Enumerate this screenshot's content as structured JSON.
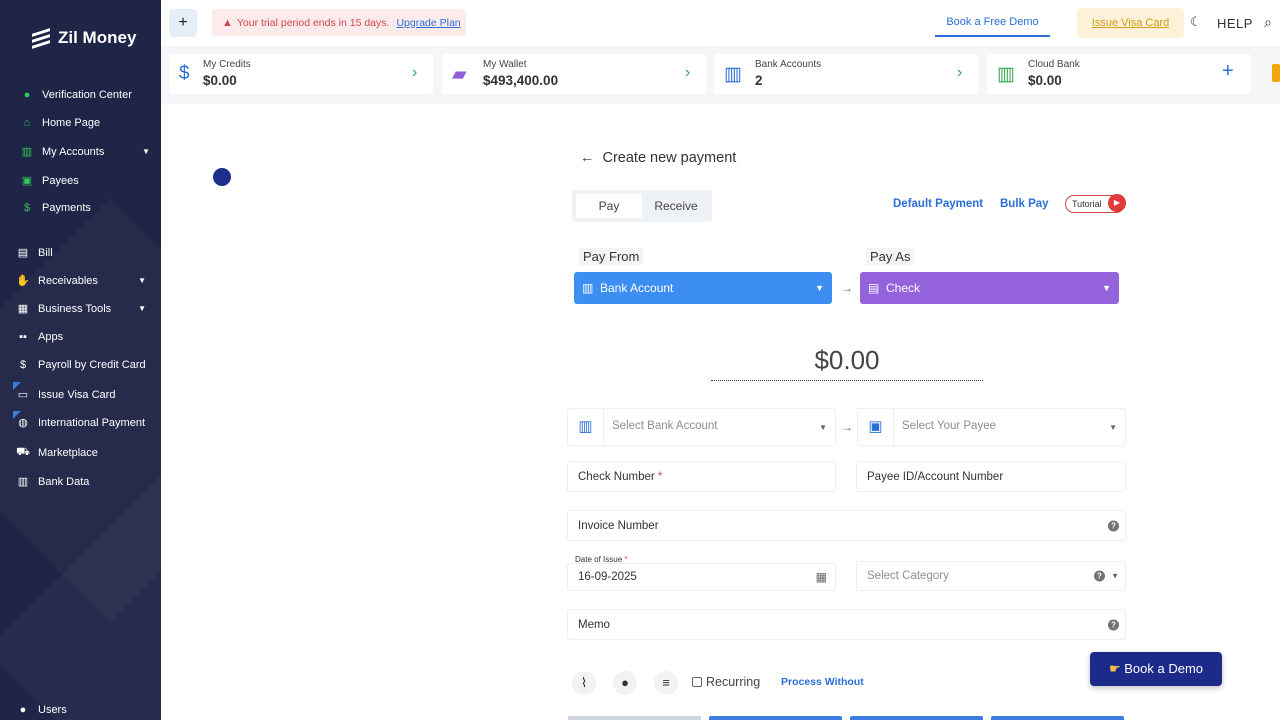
{
  "sidebar": {
    "brand": "Zil Money",
    "items": [
      {
        "label": "Verification Center",
        "icon": "check-circle-icon",
        "color": "#34c759"
      },
      {
        "label": "Home Page",
        "icon": "home-icon",
        "color": "#34c759"
      },
      {
        "label": "My Accounts",
        "icon": "bank-icon",
        "color": "#34c759"
      },
      {
        "label": "Payees",
        "icon": "contact-icon",
        "color": "#34c759"
      },
      {
        "label": "Payments",
        "icon": "dollar-icon",
        "color": "#34c759"
      },
      {
        "label": "Bill",
        "icon": "document-icon"
      },
      {
        "label": "Receivables",
        "icon": "hand-coin-icon"
      },
      {
        "label": "Business Tools",
        "icon": "briefcase-icon"
      },
      {
        "label": "Apps",
        "icon": "grid-icon"
      },
      {
        "label": "Payroll by Credit Card",
        "icon": "dollar-icon"
      },
      {
        "label": "Issue Visa Card",
        "icon": "card-icon"
      },
      {
        "label": "International Payment",
        "icon": "globe-icon"
      },
      {
        "label": "Marketplace",
        "icon": "cart-icon"
      },
      {
        "label": "Bank Data",
        "icon": "bank-icon"
      },
      {
        "label": "Users",
        "icon": "user-icon"
      }
    ]
  },
  "topbar": {
    "plus": "+",
    "trial_text": "Your trial period ends in 15 days.",
    "upgrade": "Upgrade Plan",
    "book_free_demo": "Book a Free Demo",
    "issue_visa_card": "Issue Visa Card",
    "help": "HELP"
  },
  "cards": [
    {
      "label": "My Credits",
      "value": "$0.00",
      "icon": "dollar-icon",
      "color": "#2a6fd6"
    },
    {
      "label": "My Wallet",
      "value": "$493,400.00",
      "icon": "wallet-icon",
      "color": "#8e5fd8"
    },
    {
      "label": "Bank Accounts",
      "value": "2",
      "icon": "bank-icon",
      "color": "#2a6fd6"
    },
    {
      "label": "Cloud Bank",
      "value": "$0.00",
      "icon": "bank-icon",
      "color": "#34a853"
    }
  ],
  "payment": {
    "title": "Create new payment",
    "tabs": [
      "Pay",
      "Receive"
    ],
    "default_payment": "Default Payment",
    "bulk_pay": "Bulk Pay",
    "tutorial": "Tutorial",
    "pay_from_label": "Pay From",
    "pay_from_value": "Bank Account",
    "pay_as_label": "Pay As",
    "pay_as_value": "Check",
    "amount": "$0.00",
    "select_bank_placeholder": "Select Bank Account",
    "select_payee_placeholder": "Select Your Payee",
    "check_number": "Check Number",
    "payee_id": "Payee ID/Account Number",
    "invoice_number": "Invoice Number",
    "date_of_issue_label": "Date of Issue",
    "date_of_issue": "16-09-2025",
    "select_category_placeholder": "Select Category",
    "memo": "Memo",
    "recurring": "Recurring",
    "process_without": "Process Without",
    "required_mark": "*"
  },
  "book_demo": "Book a Demo",
  "colors": {
    "sidebar_bg": "#1f2547",
    "pay_from_bg": "#3d8ef2",
    "pay_as_bg": "#9463dc",
    "accent": "#2a6fd6",
    "book_demo_bg": "#1c2a8a"
  }
}
